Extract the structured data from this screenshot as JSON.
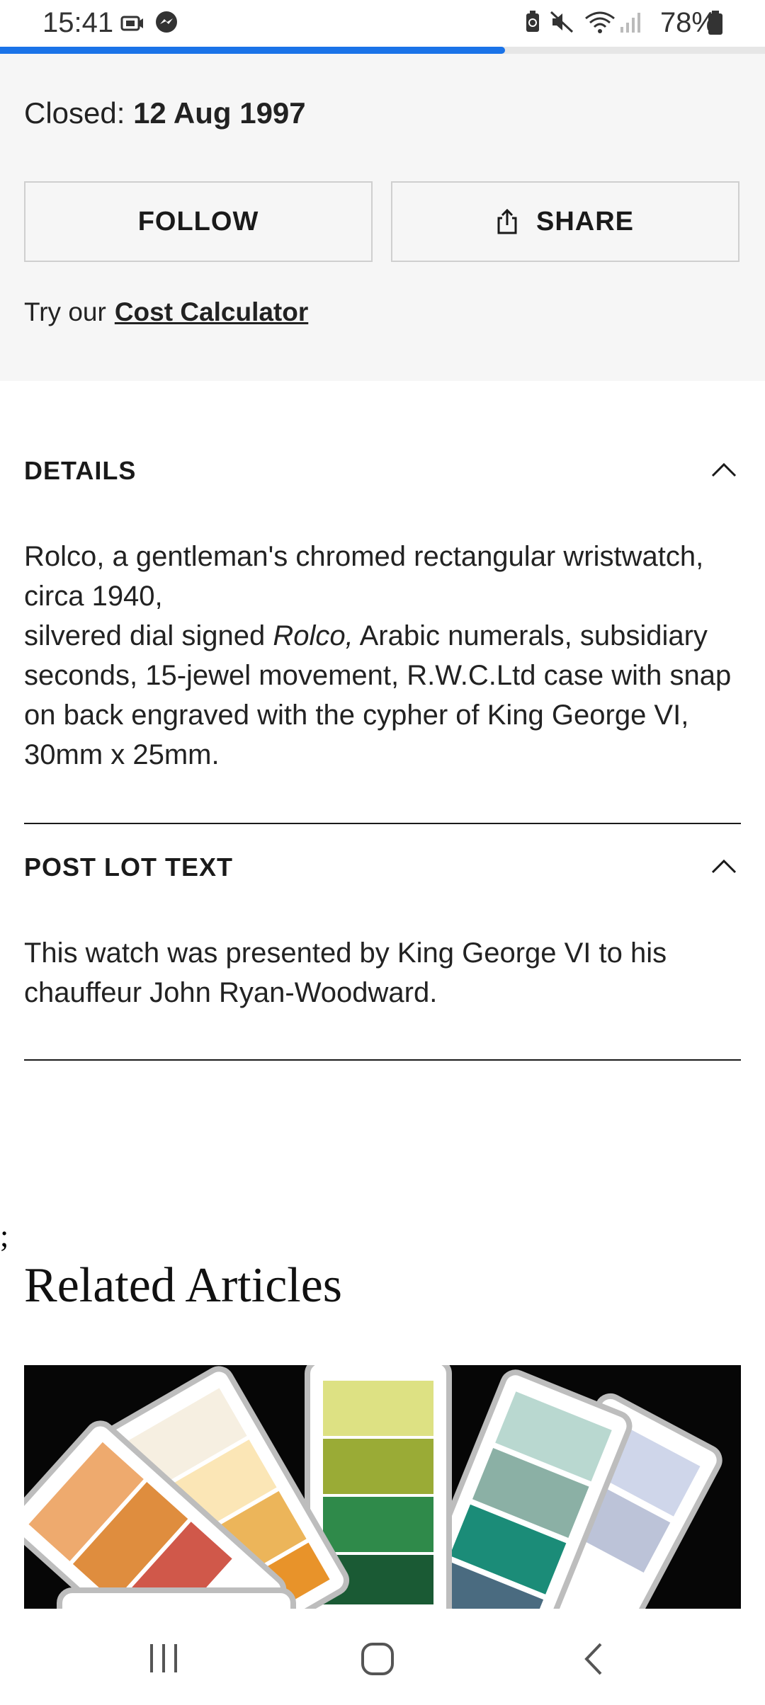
{
  "status_bar": {
    "time": "15:41",
    "battery": "78%",
    "page_progress_fraction": 0.66
  },
  "lot": {
    "closed_label": "Closed:",
    "closed_date": "12 Aug 1997",
    "follow_label": "FOLLOW",
    "share_label": "SHARE",
    "calc_prefix": "Try our",
    "calc_link": "Cost Calculator"
  },
  "details": {
    "title": "DETAILS",
    "line1": "Rolco, a gentleman's chromed rectangular wristwatch, circa 1940,",
    "line2_pre": "silvered dial signed ",
    "line2_italic": "Rolco,",
    "line2_post": " Arabic numerals, subsidiary seconds, 15-jewel movement, R.W.C.Ltd case with snap on back engraved with the cypher of King George VI, 30mm x 25mm."
  },
  "post_lot": {
    "title": "POST LOT TEXT",
    "text": "This watch was presented by King George VI to his chauffeur John Ryan-Woodward."
  },
  "stray_text": ";",
  "related": {
    "title": "Related Articles"
  },
  "icons": {
    "share": "share-icon",
    "chevron": "chevron-up-icon",
    "nav_recent": "recent-apps-icon",
    "nav_home": "home-icon",
    "nav_back": "back-icon"
  }
}
